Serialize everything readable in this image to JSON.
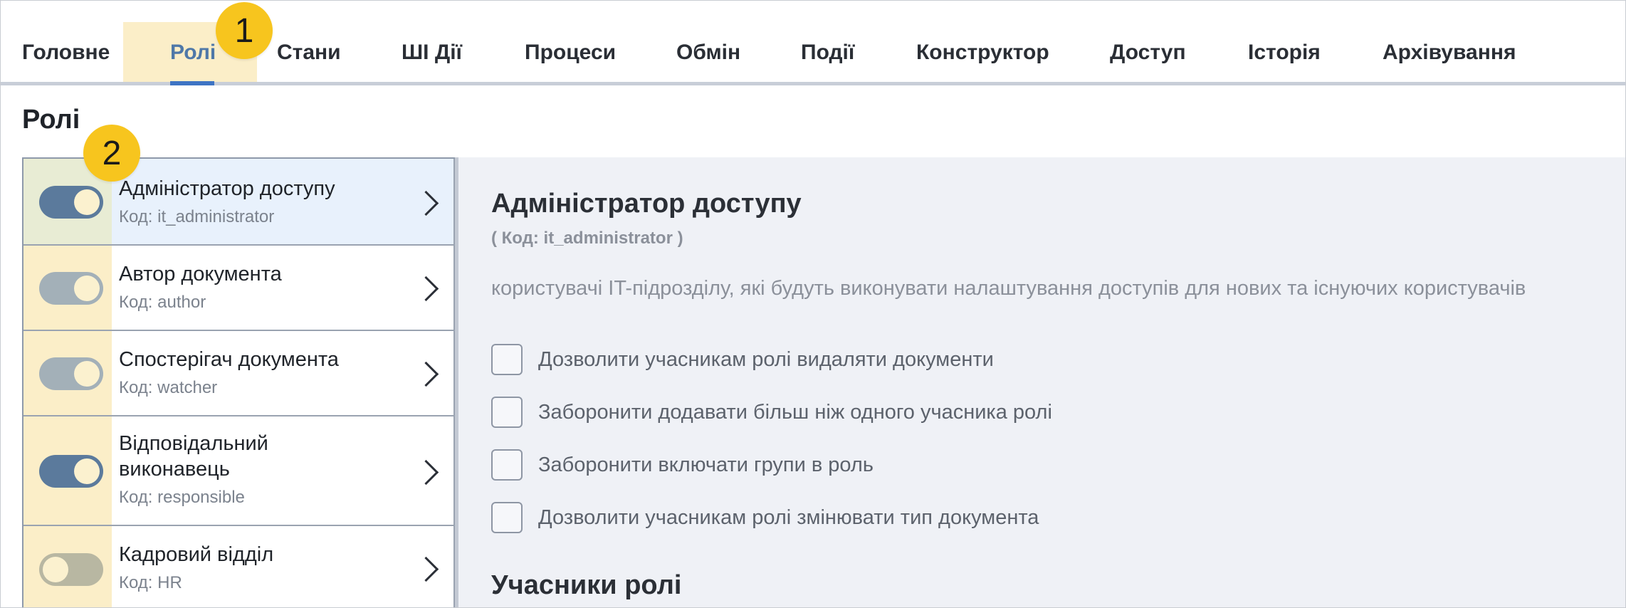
{
  "tabs": [
    {
      "label": "Головне"
    },
    {
      "label": "Ролі",
      "active": true
    },
    {
      "label": "Стани"
    },
    {
      "label": "ШІ Дії"
    },
    {
      "label": "Процеси"
    },
    {
      "label": "Обмін"
    },
    {
      "label": "Події"
    },
    {
      "label": "Конструктор"
    },
    {
      "label": "Доступ"
    },
    {
      "label": "Історія"
    },
    {
      "label": "Архівування"
    }
  ],
  "badges": {
    "first": "1",
    "second": "2"
  },
  "section_title": "Ролі",
  "roles": [
    {
      "name": "Адміністратор доступу",
      "code": "Код: it_administrator",
      "enabled": true,
      "toggle_color": "#5b7a9c"
    },
    {
      "name": "Автор документа",
      "code": "Код: author",
      "enabled": true,
      "toggle_color": "#a3b0b8"
    },
    {
      "name": "Спостерігач документа",
      "code": "Код: watcher",
      "enabled": true,
      "toggle_color": "#a3b0b8"
    },
    {
      "name": "Відповідальний виконавець",
      "name_line1": "Відповідальний",
      "name_line2": "виконавець",
      "code": "Код: responsible",
      "enabled": true,
      "toggle_color": "#5b7a9c"
    },
    {
      "name": "Кадровий відділ",
      "code": "Код: HR",
      "enabled": false,
      "toggle_color": "#b8b7a2"
    }
  ],
  "detail": {
    "title": "Адміністратор доступу",
    "code": "( Код: it_administrator )",
    "description": "користувачі IT-підрозділу, які будуть виконувати налаштування доступів для нових та існуючих користувачів",
    "options": [
      {
        "label": "Дозволити учасникам ролі видаляти документи",
        "checked": false
      },
      {
        "label": "Заборонити додавати більш ніж одного учасника ролі",
        "checked": false
      },
      {
        "label": "Заборонити включати групи в роль",
        "checked": false
      },
      {
        "label": "Дозволити учасникам ролі змінювати тип документа",
        "checked": false
      }
    ],
    "members_title": "Учасники ролі"
  },
  "colors": {
    "accent": "#3e74c4",
    "highlight": "#fbeec8",
    "badge": "#f7c51e",
    "selected_row": "#e8f1fc",
    "panel_bg": "#eff1f6"
  }
}
